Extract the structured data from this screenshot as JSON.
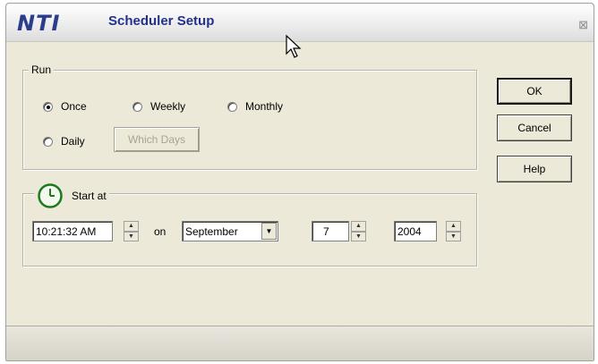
{
  "window": {
    "brand": "NTI",
    "title": "Scheduler Setup",
    "close_glyph": "⊠"
  },
  "run_group": {
    "legend": "Run",
    "options": {
      "once": "Once",
      "weekly": "Weekly",
      "monthly": "Monthly",
      "daily": "Daily"
    },
    "selected": "once",
    "which_days_label": "Which Days"
  },
  "start_group": {
    "legend": "Start at",
    "icon": "clock-icon",
    "time_value": "10:21:32 AM",
    "on_label": "on",
    "month_value": "September",
    "day_value": "7",
    "year_value": "2004"
  },
  "buttons": {
    "ok": "OK",
    "cancel": "Cancel",
    "help": "Help"
  }
}
